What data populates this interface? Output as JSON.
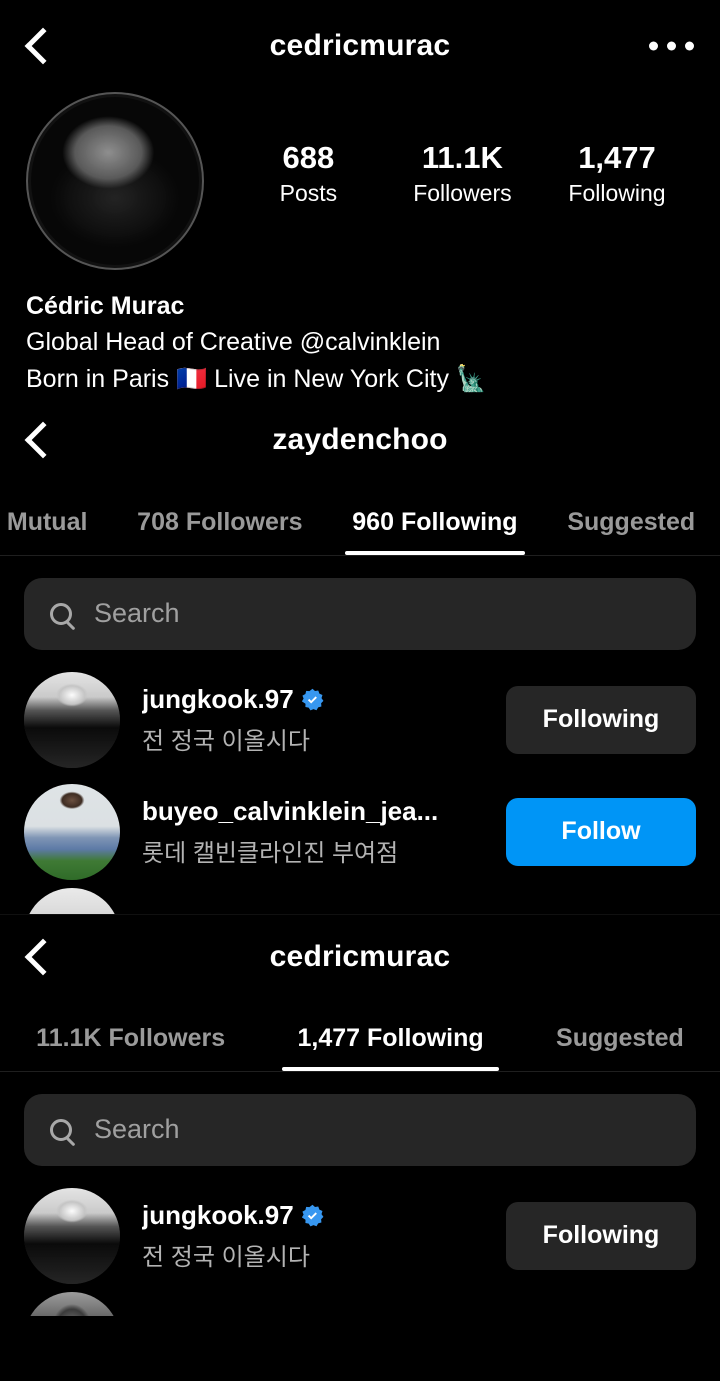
{
  "colors": {
    "background": "#000000",
    "surface": "#262626",
    "primary_blue": "#0095F6",
    "verified_blue": "#3797F0",
    "text_primary": "#FFFFFF",
    "text_secondary": "#A8A8A8",
    "tab_inactive": "#9A9A9A"
  },
  "profile_header": {
    "back_icon": "chevron-left-icon",
    "title": "cedricmurac",
    "menu_icon": "more-options-icon",
    "avatar_icon": "profile-avatar",
    "stats": [
      {
        "number": "688",
        "label": "Posts"
      },
      {
        "number": "11.1K",
        "label": "Followers"
      },
      {
        "number": "1,477",
        "label": "Following"
      }
    ],
    "bio": {
      "display_name": "Cédric Murac",
      "line1": "Global Head of Creative @calvinklein",
      "line2": "Born in Paris 🇫🇷  Live in New York City 🗽"
    }
  },
  "section_zaydenchoo": {
    "back_icon": "chevron-left-icon",
    "title": "zaydenchoo",
    "tabs": [
      {
        "label": "Mutual",
        "active": false
      },
      {
        "label": "708 Followers",
        "active": false
      },
      {
        "label": "960 Following",
        "active": true
      },
      {
        "label": "Suggested",
        "active": false
      }
    ],
    "search": {
      "icon": "search-icon",
      "placeholder": "Search",
      "value": ""
    },
    "users": [
      {
        "username": "jungkook.97",
        "verified": true,
        "full_name": "전 정국 이올시다",
        "button_label": "Following",
        "button_style": "ghost",
        "avatar_icon": "user-avatar-jungkook"
      },
      {
        "username": "buyeo_calvinklein_jea...",
        "verified": false,
        "full_name": "롯데 캘빈클라인진 부여점",
        "button_label": "Follow",
        "button_style": "primary",
        "avatar_icon": "user-avatar-buyeo"
      }
    ]
  },
  "section_cedricmurac": {
    "back_icon": "chevron-left-icon",
    "title": "cedricmurac",
    "tabs": [
      {
        "label": "11.1K Followers",
        "active": false
      },
      {
        "label": "1,477 Following",
        "active": true
      },
      {
        "label": "Suggested",
        "active": false
      }
    ],
    "search": {
      "icon": "search-icon",
      "placeholder": "Search",
      "value": ""
    },
    "users": [
      {
        "username": "jungkook.97",
        "verified": true,
        "full_name": "전 정국 이올시다",
        "button_label": "Following",
        "button_style": "ghost",
        "avatar_icon": "user-avatar-jungkook"
      }
    ]
  }
}
